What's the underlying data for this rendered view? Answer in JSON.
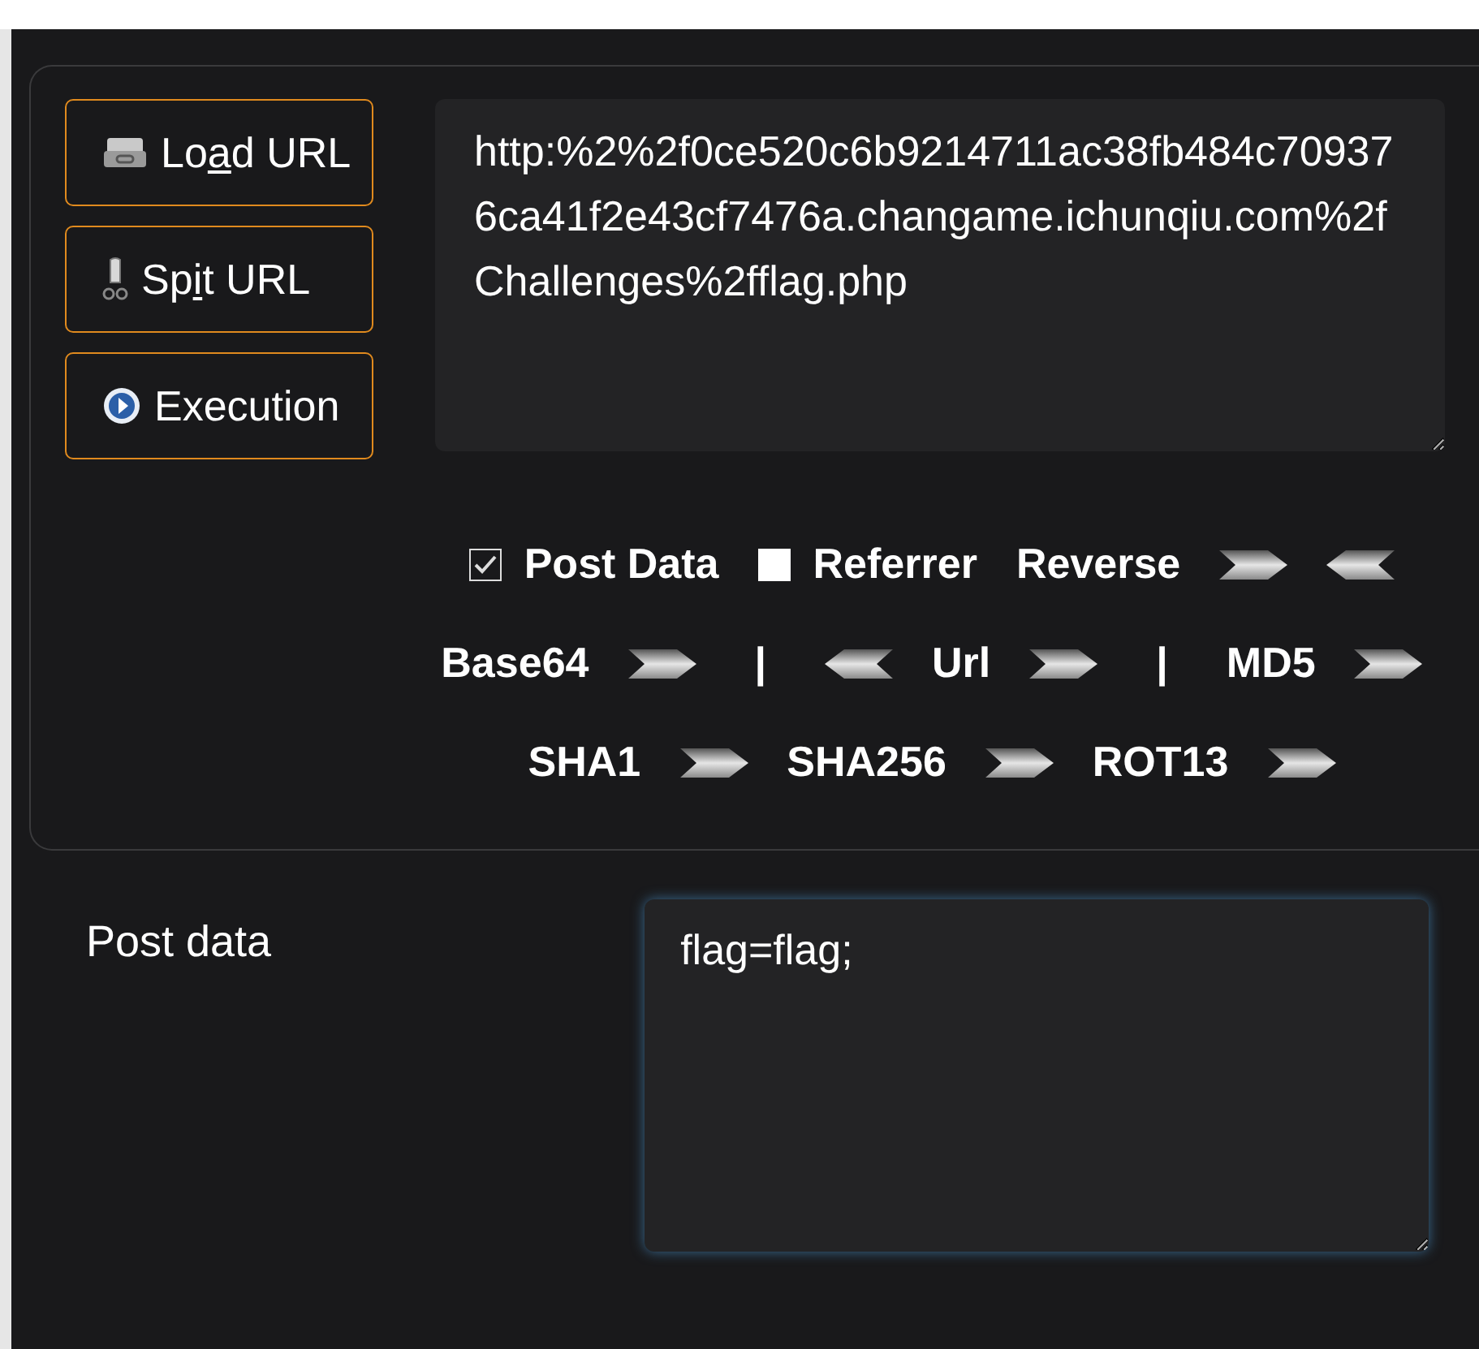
{
  "buttons": [
    {
      "kind": "load",
      "label_before": "Lo",
      "access_key": "a",
      "label_after": "d URL"
    },
    {
      "kind": "split",
      "label_before": "Sp",
      "access_key": "i",
      "label_after": "t URL"
    },
    {
      "kind": "execute",
      "label_before": "Execution"
    }
  ],
  "url_field": {
    "value": "http:%2%2f0ce520c6b9214711ac38fb484c709376ca41f2e43cf7476a.changame.ichunqiu.com%2fChallenges%2fflag.php"
  },
  "toolbar": {
    "items": [
      {
        "kind": "checkbox",
        "label": "Post Data",
        "checked": true
      },
      {
        "kind": "checkbox",
        "label": "Referrer",
        "checked": false
      },
      {
        "kind": "label",
        "label": "Reverse"
      },
      {
        "kind": "encode"
      },
      {
        "kind": "decode"
      },
      {
        "kind": "label",
        "label": "Base64"
      },
      {
        "kind": "encode"
      },
      {
        "kind": "separator",
        "label": "|"
      },
      {
        "kind": "decode"
      },
      {
        "kind": "label",
        "label": "Url"
      },
      {
        "kind": "encode"
      },
      {
        "kind": "separator",
        "label": "|"
      },
      {
        "kind": "label",
        "label": "MD5"
      },
      {
        "kind": "encode"
      },
      {
        "kind": "label",
        "label": "SHA1"
      },
      {
        "kind": "encode"
      },
      {
        "kind": "label",
        "label": "SHA256"
      },
      {
        "kind": "encode"
      },
      {
        "kind": "label",
        "label": "ROT13"
      },
      {
        "kind": "encode"
      }
    ]
  },
  "post_data": {
    "label": "Post data",
    "value": "flag=flag;"
  }
}
